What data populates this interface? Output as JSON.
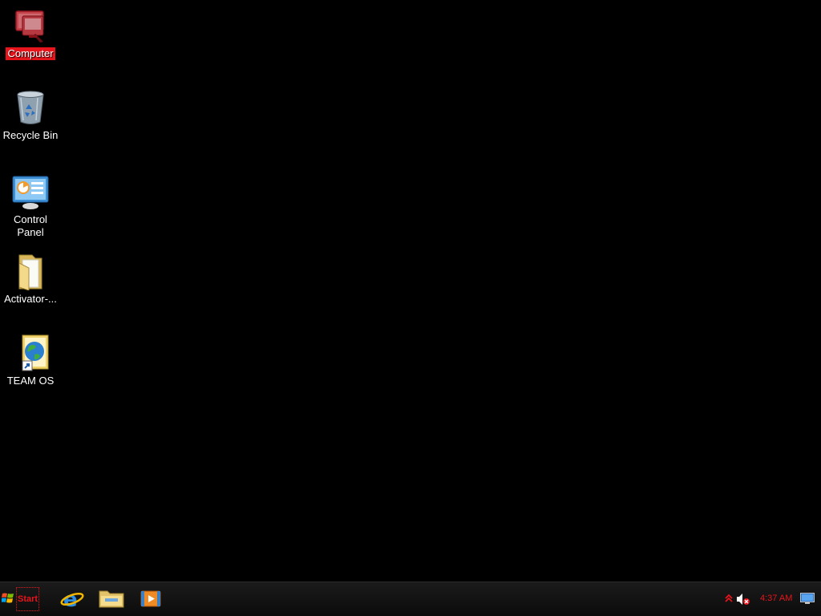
{
  "desktop": {
    "icons": [
      {
        "label": "Computer",
        "icon": "computer-icon",
        "selected": true
      },
      {
        "label": "Recycle Bin",
        "icon": "recycle-bin-icon"
      },
      {
        "label": "Control Panel",
        "icon": "control-panel-icon"
      },
      {
        "label": "Activator-...",
        "icon": "folder-icon"
      },
      {
        "label": "TEAM OS",
        "icon": "globe-shortcut-icon"
      }
    ]
  },
  "taskbar": {
    "start_label": "Start",
    "pinned": [
      {
        "icon": "internet-explorer-icon"
      },
      {
        "icon": "file-explorer-icon"
      },
      {
        "icon": "media-player-icon"
      }
    ],
    "tray": {
      "clock": "4:37 AM",
      "icons": [
        "show-hidden-icons-icon",
        "volume-muted-icon",
        "show-desktop-icon"
      ]
    }
  },
  "colors": {
    "accent": "#e8141b",
    "background": "#000000",
    "taskbar": "#111111"
  }
}
